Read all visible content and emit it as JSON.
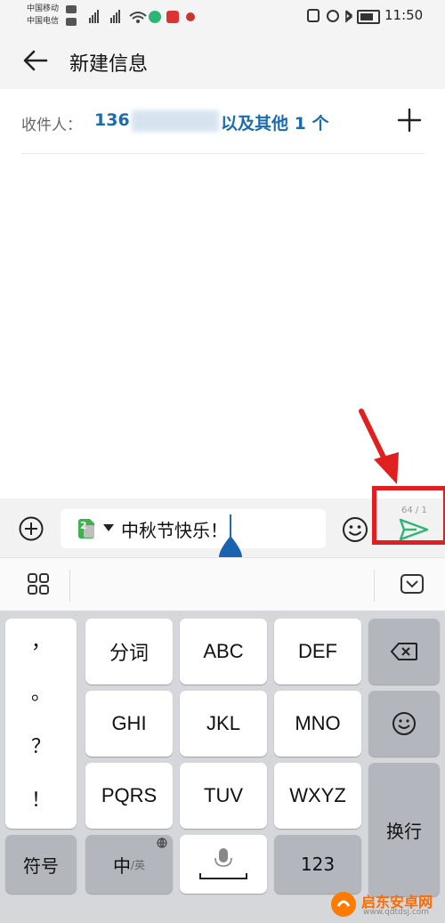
{
  "status_bar": {
    "carrier1": "中国移动",
    "carrier2": "中国电信",
    "time": "11:50"
  },
  "header": {
    "title": "新建信息"
  },
  "recipients": {
    "label": "收件人：",
    "number_prefix": "136",
    "more_text": "以及其他 1 个"
  },
  "compose": {
    "sim_badge": "2",
    "message": "中秋节快乐！",
    "counter": "64 / 1"
  },
  "keyboard": {
    "punct": [
      "，",
      "。",
      "？",
      "！"
    ],
    "row1": [
      "分词",
      "ABC",
      "DEF"
    ],
    "row2": [
      "GHI",
      "JKL",
      "MNO"
    ],
    "row3": [
      "PQRS",
      "TUV",
      "WXYZ"
    ],
    "symbol": "符号",
    "lang_main": "中",
    "lang_alt": "/英",
    "num": "123",
    "enter": "换行"
  },
  "watermark": {
    "name": "启东安卓网",
    "url": "www.qdtdsj.com"
  },
  "colors": {
    "accent": "#1a6bb0",
    "send": "#2bb673",
    "highlight": "#e02020"
  }
}
